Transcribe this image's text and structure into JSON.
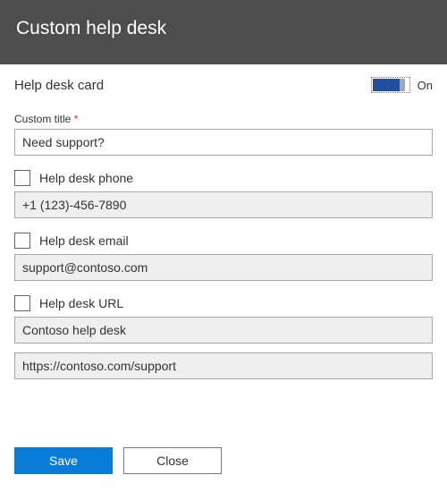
{
  "header": {
    "title": "Custom help desk"
  },
  "card": {
    "label": "Help desk card",
    "toggle_state_label": "On"
  },
  "fields": {
    "custom_title_label": "Custom title",
    "required_mark": "*",
    "custom_title_value": "Need support?",
    "phone_label": "Help desk phone",
    "phone_value": "+1 (123)-456-7890",
    "email_label": "Help desk email",
    "email_value": "support@contoso.com",
    "url_label": "Help desk URL",
    "url_title_value": "Contoso help desk",
    "url_value": "https://contoso.com/support"
  },
  "footer": {
    "save_label": "Save",
    "close_label": "Close"
  }
}
